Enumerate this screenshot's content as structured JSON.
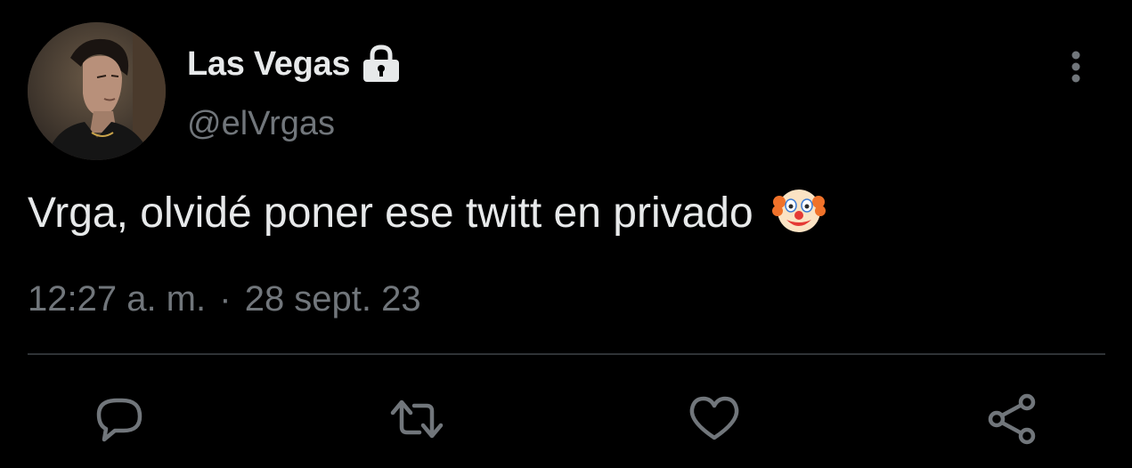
{
  "tweet": {
    "display_name": "Las Vegas",
    "handle": "@elVrgas",
    "text": "Vrga, olvidé poner ese twitt en privado",
    "emoji": "clown-face",
    "time": "12:27 a. m.",
    "separator": "·",
    "date": "28 sept. 23",
    "protected_icon": "lock-icon"
  },
  "actions": {
    "reply_icon": "comment-icon",
    "retweet_icon": "retweet-icon",
    "like_icon": "heart-icon",
    "share_icon": "share-icon",
    "more_icon": "vertical-dots-icon"
  },
  "colors": {
    "background": "#000000",
    "primary_text": "#e7e9ea",
    "secondary_text": "#71767b",
    "divider": "#2f3336"
  }
}
